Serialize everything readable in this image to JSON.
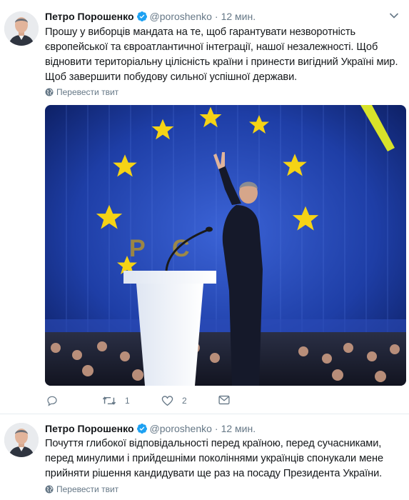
{
  "tweets": [
    {
      "author": {
        "name": "Петро Порошенко",
        "handle": "@poroshenko"
      },
      "time": "12 мин.",
      "text": "Прошу у виборців мандата на те, щоб гарантувати незворотність європейської та євроатлантичної інтеграції, нашої незалежності. Щоб відновити територіальну цілісність країни і принести вигідний Україні мир. Щоб завершити побудову сильної успішної держави.",
      "translate_label": "Перевести твит",
      "media_image": "politician-waving-on-stage-eu-flag-backdrop",
      "actions": {
        "reply": "",
        "retweet": "1",
        "like": "2",
        "message": ""
      }
    },
    {
      "author": {
        "name": "Петро Порошенко",
        "handle": "@poroshenko"
      },
      "time": "12 мин.",
      "text": "Почуття глибокої відповідальності перед країною, перед сучасниками, перед минулими і прийдешніми поколіннями українців спонукали мене прийняти рішення кандидувати ще раз на посаду Президента України.",
      "translate_label": "Перевести твит"
    }
  ],
  "colors": {
    "verified": "#1da1f2",
    "secondary_text": "#657786",
    "eu_blue": "#1d3fa8",
    "star_yellow": "#f5d315"
  },
  "icons": [
    "verified-badge-icon",
    "chevron-down-icon",
    "globe-icon",
    "reply-icon",
    "retweet-icon",
    "like-icon",
    "direct-message-icon"
  ]
}
